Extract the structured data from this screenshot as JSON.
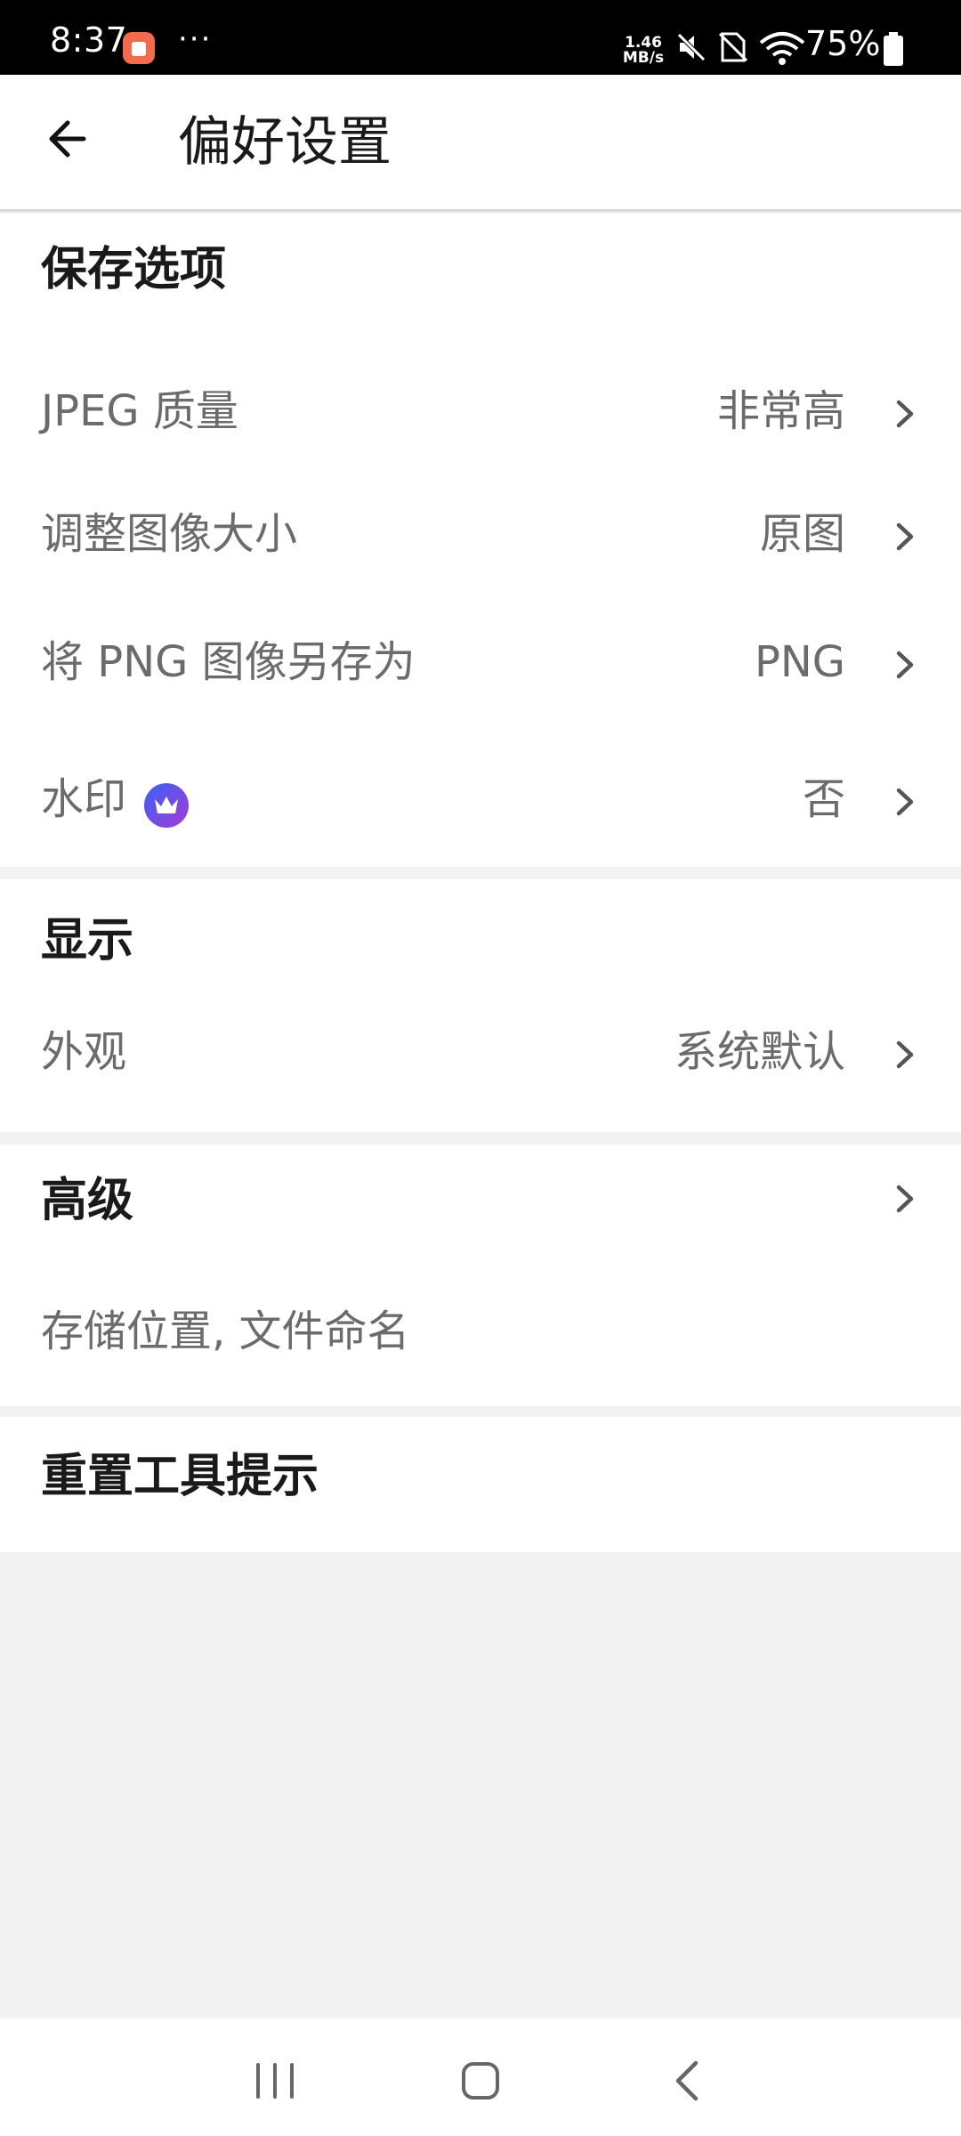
{
  "status_bar": {
    "time": "8:37",
    "dots": "···",
    "net_speed_value": "1.46",
    "net_speed_unit": "MB/s",
    "battery": "75%"
  },
  "header": {
    "title": "偏好设置",
    "back_icon": "arrow-left-icon"
  },
  "sections": {
    "save": {
      "title": "保存选项",
      "rows": [
        {
          "label": "JPEG 质量",
          "value": "非常高"
        },
        {
          "label": "调整图像大小",
          "value": "原图"
        },
        {
          "label": "将 PNG 图像另存为",
          "value": "PNG"
        },
        {
          "label": "水印",
          "value": "否",
          "badge_icon": "crown-icon"
        }
      ]
    },
    "display": {
      "title": "显示",
      "rows": [
        {
          "label": "外观",
          "value": "系统默认"
        }
      ]
    },
    "advanced": {
      "title": "高级",
      "subtitle": "存储位置, 文件命名"
    },
    "reset": {
      "title": "重置工具提示"
    }
  },
  "colors": {
    "premium_start": "#3a62f2",
    "premium_end": "#a33bd8",
    "app_icon": "#f26b4f"
  }
}
